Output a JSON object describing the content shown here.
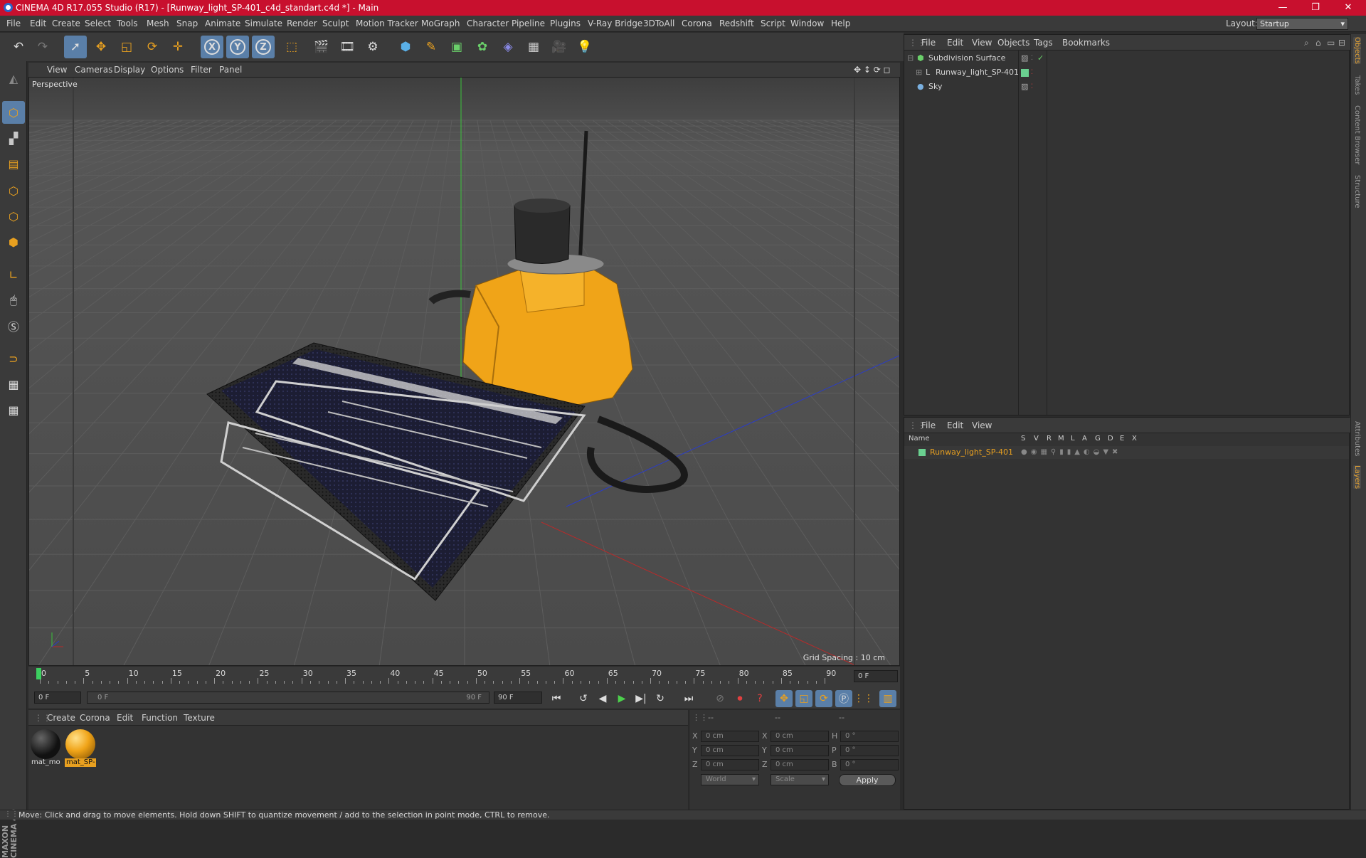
{
  "window": {
    "title": "CINEMA 4D R17.055 Studio (R17) - [Runway_light_SP-401_c4d_standart.c4d *] - Main",
    "controls": [
      "—",
      "❐",
      "✕"
    ]
  },
  "menubar": {
    "items": [
      "File",
      "Edit",
      "Create",
      "Select",
      "Tools",
      "Mesh",
      "Snap",
      "Animate",
      "Simulate",
      "Render",
      "Sculpt",
      "Motion Tracker",
      "MoGraph",
      "Character",
      "Pipeline",
      "Plugins",
      "V-Ray Bridge",
      "3DToAll",
      "Corona",
      "Redshift",
      "Script",
      "Window",
      "Help"
    ],
    "layout_label": "Layout:",
    "layout_value": "Startup"
  },
  "toolbar": {
    "icons": [
      "undo-icon",
      "redo-icon",
      "select-icon",
      "move-icon",
      "scale-icon",
      "rotate-icon",
      "move-all-icon",
      "x-axis-icon",
      "y-axis-icon",
      "z-axis-icon",
      "coordinate-system-icon",
      "render-view-icon",
      "render-picture-viewer-icon",
      "render-settings-icon",
      "cube-icon",
      "pen-icon",
      "subdivision-icon",
      "mograph-cloner-icon",
      "deformer-icon",
      "floor-icon",
      "camera-icon",
      "light-icon"
    ],
    "axis_labels": [
      "X",
      "Y",
      "Z"
    ]
  },
  "viewport": {
    "menu": [
      "View",
      "Cameras",
      "Display",
      "Options",
      "Filter",
      "Panel"
    ],
    "label": "Perspective",
    "grid_spacing": "Grid Spacing : 10 cm",
    "accent": "#e8a020"
  },
  "timeline": {
    "ticks": [
      "0",
      "5",
      "10",
      "15",
      "20",
      "25",
      "30",
      "35",
      "40",
      "45",
      "50",
      "55",
      "60",
      "65",
      "70",
      "75",
      "80",
      "85",
      "90"
    ],
    "current_frame": "0 F",
    "start_field": "0 F",
    "range_start": "0 F",
    "range_end": "90 F",
    "end_field": "90 F"
  },
  "materials": {
    "menu": [
      "Create",
      "Corona",
      "Edit",
      "Function",
      "Texture"
    ],
    "items": [
      {
        "label": "mat_mo",
        "selected": false,
        "color": "#1a1a1a"
      },
      {
        "label": "mat_SP-",
        "selected": true,
        "color": "#f0a418"
      }
    ]
  },
  "coordinates": {
    "header": [
      "--",
      "--",
      "--"
    ],
    "pos": [
      {
        "axis": "X",
        "value": "0 cm"
      },
      {
        "axis": "Y",
        "value": "0 cm"
      },
      {
        "axis": "Z",
        "value": "0 cm"
      }
    ],
    "size": [
      {
        "axis": "X",
        "value": "0 cm"
      },
      {
        "axis": "Y",
        "value": "0 cm"
      },
      {
        "axis": "Z",
        "value": "0 cm"
      }
    ],
    "rot": [
      {
        "axis": "H",
        "value": "0 °"
      },
      {
        "axis": "P",
        "value": "0 °"
      },
      {
        "axis": "B",
        "value": "0 °"
      }
    ],
    "mode1": "World",
    "mode2": "Scale",
    "apply": "Apply"
  },
  "objects": {
    "menu": [
      "File",
      "Edit",
      "View",
      "Objects",
      "Tags",
      "Bookmarks"
    ],
    "rows": [
      {
        "name": "Subdivision Surface",
        "color": "#c8c8c8"
      },
      {
        "name": "Runway_light_SP-401",
        "color": "#c8c8c8"
      },
      {
        "name": "Sky",
        "color": "#c8c8c8"
      }
    ]
  },
  "layers": {
    "menu": [
      "File",
      "Edit",
      "View"
    ],
    "columns": [
      "Name",
      "S",
      "V",
      "R",
      "M",
      "L",
      "A",
      "G",
      "D",
      "E",
      "X"
    ],
    "rows": [
      {
        "name": "Runway_light_SP-401",
        "color": "#e8a020"
      }
    ]
  },
  "side_tabs": [
    "Objects",
    "Takes",
    "Content Browser",
    "Structure",
    "Attributes",
    "Layers"
  ],
  "status": "Move: Click and drag to move elements. Hold down SHIFT to quantize movement / add to the selection in point mode, CTRL to remove.",
  "branding": "MAXON CINEMA 4D"
}
